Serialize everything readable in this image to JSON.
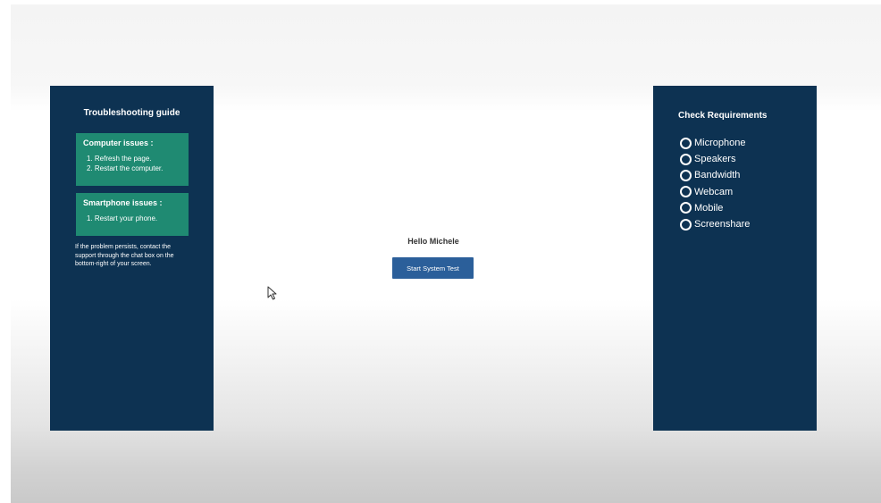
{
  "troubleshooting": {
    "title": "Troubleshooting guide",
    "computer": {
      "title": "Computer issues :",
      "items": [
        "1. Refresh the page.",
        "2. Restart the computer."
      ]
    },
    "smartphone": {
      "title": "Smartphone issues :",
      "items": [
        "1. Restart your phone."
      ]
    },
    "note": "If the problem persists, contact the support through the chat box on the bottom-right of your screen."
  },
  "main": {
    "greeting": "Hello Michele",
    "start_button": "Start System Test"
  },
  "requirements": {
    "title": "Check Requirements",
    "items": [
      "Microphone",
      "Speakers",
      "Bandwidth",
      "Webcam",
      "Mobile",
      "Screenshare"
    ]
  },
  "colors": {
    "panel": "#0d3252",
    "issue_box": "#1f8a72",
    "button": "#2b5f9a"
  },
  "icons": {
    "requirement_status": "radio-unchecked-icon",
    "pointer": "mouse-cursor-icon"
  }
}
